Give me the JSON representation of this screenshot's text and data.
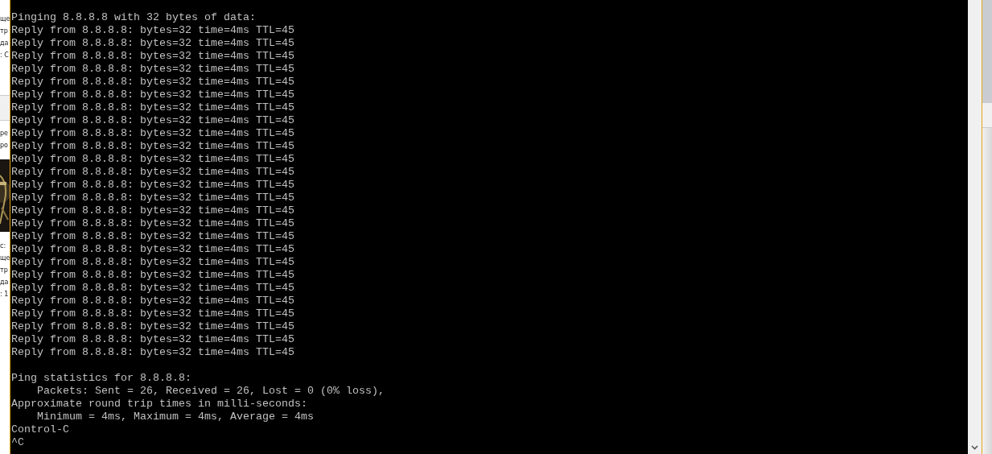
{
  "background_window": {
    "fragments_top": [
      "ще",
      "тр",
      "да",
      ": С"
    ],
    "fragments_middle": [
      "ре",
      "ро"
    ],
    "picture": {
      "kind": "picture"
    },
    "fragments_bottom": [
      "с:",
      "ще",
      "тр",
      "да",
      ": 1"
    ]
  },
  "console": {
    "lines": [
      "Pinging 8.8.8.8 with 32 bytes of data:",
      "Reply from 8.8.8.8: bytes=32 time=4ms TTL=45",
      "Reply from 8.8.8.8: bytes=32 time=4ms TTL=45",
      "Reply from 8.8.8.8: bytes=32 time=4ms TTL=45",
      "Reply from 8.8.8.8: bytes=32 time=4ms TTL=45",
      "Reply from 8.8.8.8: bytes=32 time=4ms TTL=45",
      "Reply from 8.8.8.8: bytes=32 time=4ms TTL=45",
      "Reply from 8.8.8.8: bytes=32 time=4ms TTL=45",
      "Reply from 8.8.8.8: bytes=32 time=4ms TTL=45",
      "Reply from 8.8.8.8: bytes=32 time=4ms TTL=45",
      "Reply from 8.8.8.8: bytes=32 time=4ms TTL=45",
      "Reply from 8.8.8.8: bytes=32 time=4ms TTL=45",
      "Reply from 8.8.8.8: bytes=32 time=4ms TTL=45",
      "Reply from 8.8.8.8: bytes=32 time=4ms TTL=45",
      "Reply from 8.8.8.8: bytes=32 time=4ms TTL=45",
      "Reply from 8.8.8.8: bytes=32 time=4ms TTL=45",
      "Reply from 8.8.8.8: bytes=32 time=4ms TTL=45",
      "Reply from 8.8.8.8: bytes=32 time=4ms TTL=45",
      "Reply from 8.8.8.8: bytes=32 time=4ms TTL=45",
      "Reply from 8.8.8.8: bytes=32 time=4ms TTL=45",
      "Reply from 8.8.8.8: bytes=32 time=4ms TTL=45",
      "Reply from 8.8.8.8: bytes=32 time=4ms TTL=45",
      "Reply from 8.8.8.8: bytes=32 time=4ms TTL=45",
      "Reply from 8.8.8.8: bytes=32 time=4ms TTL=45",
      "Reply from 8.8.8.8: bytes=32 time=4ms TTL=45",
      "Reply from 8.8.8.8: bytes=32 time=4ms TTL=45",
      "Reply from 8.8.8.8: bytes=32 time=4ms TTL=45"
    ],
    "statistics": [
      "Ping statistics for 8.8.8.8:",
      "    Packets: Sent = 26, Received = 26, Lost = 0 (0% loss),",
      "Approximate round trip times in milli-seconds:",
      "    Minimum = 4ms, Maximum = 4ms, Average = 4ms",
      "Control-C",
      "^C"
    ]
  }
}
